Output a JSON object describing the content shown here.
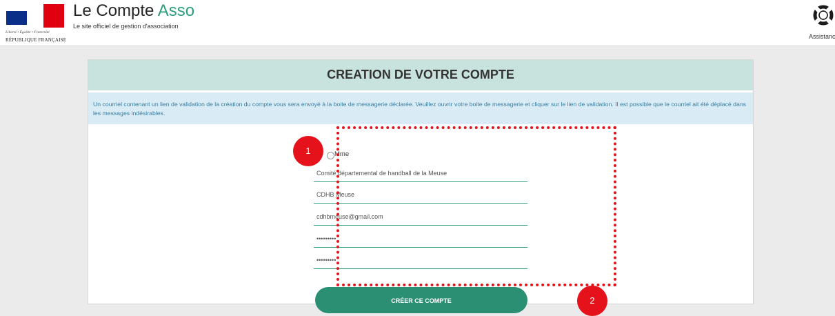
{
  "header": {
    "logo": {
      "devise": "Liberté • Égalité • Fraternité",
      "country": "RÉPUBLIQUE FRANÇAISE"
    },
    "title_part1": "Le Compte ",
    "title_part2": "Asso",
    "subtitle": "Le site officiel de gestion d'association",
    "assistance_label": "Assistance",
    "assistance_icon": "lifebuoy-icon"
  },
  "card": {
    "title": "CREATION DE VOTRE COMPTE",
    "notice": "Un courriel contenant un lien de validation de la création du compte vous sera envoyé à la boite de messagerie déclarée. Veuillez ouvrir votre boite de messagerie et cliquer sur le lien de validation. Il est possible que le courriel ait été déplacé dans les messages indésirables."
  },
  "form": {
    "civility_option": "Mme",
    "fields": [
      {
        "value": "Comité départemental de handball de la Meuse"
      },
      {
        "value": "CDHB Meuse"
      },
      {
        "value": "cdhbmeuse@gmail.com"
      },
      {
        "value": "•••••••••"
      },
      {
        "value": "•••••••••"
      }
    ],
    "submit_label": "CRÉER CE COMPTE"
  },
  "annotations": {
    "badge1": "1",
    "badge2": "2"
  },
  "colors": {
    "accent_green": "#2e9f7c",
    "button_green": "#2a8f73",
    "card_header_bg": "#c8e3dd",
    "notice_bg": "#d9ecf5",
    "annotation_red": "#e5121b"
  }
}
